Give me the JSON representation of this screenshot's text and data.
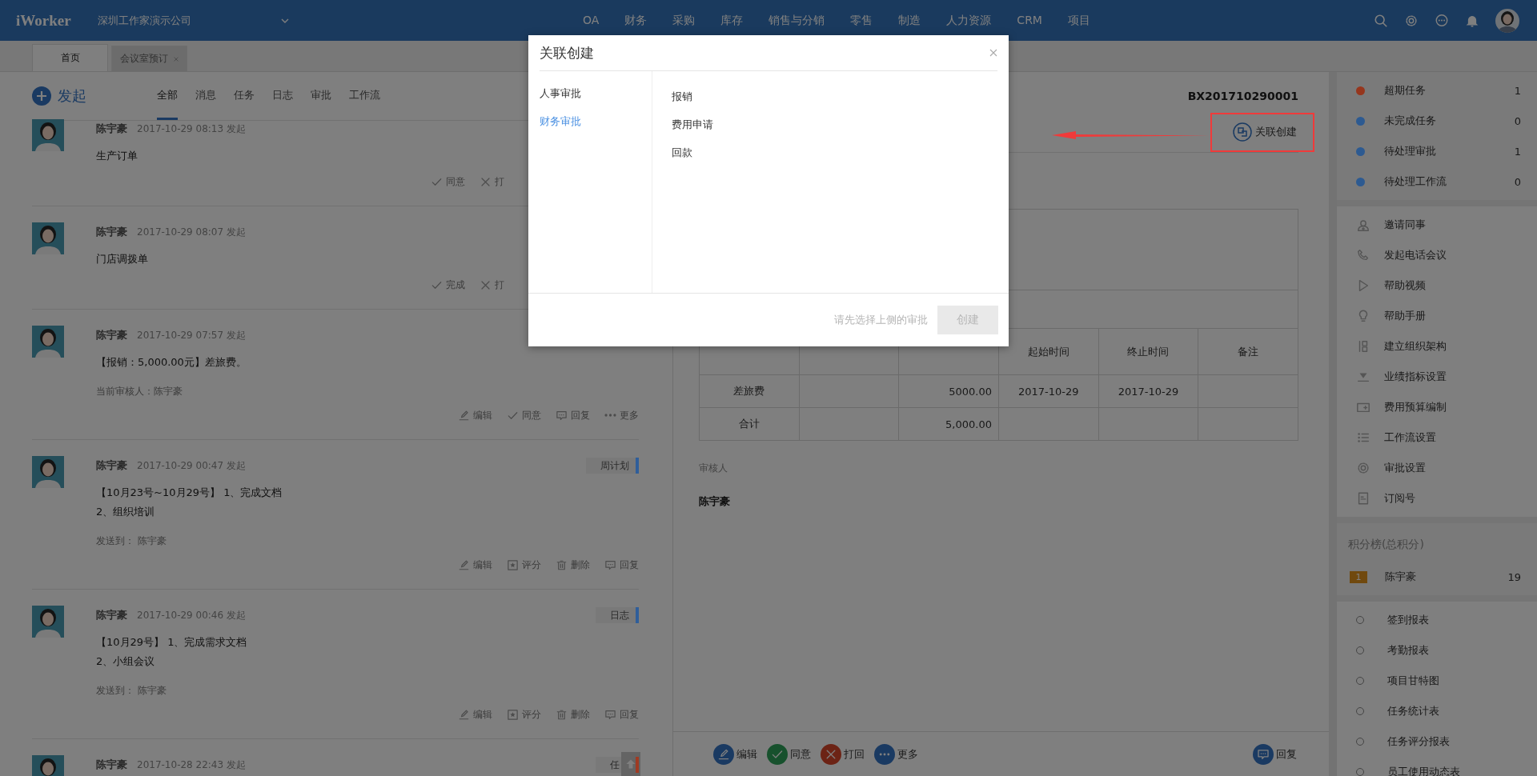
{
  "topbar": {
    "logo": "iWorker",
    "company": "深圳工作家演示公司",
    "nav": [
      "OA",
      "财务",
      "采购",
      "库存",
      "销售与分销",
      "零售",
      "制造",
      "人力资源",
      "CRM",
      "项目"
    ]
  },
  "page_tabs": [
    {
      "label": "首页",
      "selected": true,
      "closable": false
    },
    {
      "label": "会议室预订",
      "selected": false,
      "closable": true
    }
  ],
  "feed": {
    "new_button": "发起",
    "filters": [
      {
        "label": "全部",
        "selected": true
      },
      {
        "label": "消息",
        "selected": false
      },
      {
        "label": "任务",
        "selected": false
      },
      {
        "label": "日志",
        "selected": false
      },
      {
        "label": "审批",
        "selected": false
      },
      {
        "label": "工作流",
        "selected": false
      }
    ],
    "items": [
      {
        "name": "陈宇豪",
        "time": "2017-10-29 08:13 发起",
        "body": [
          "生产订单"
        ],
        "actions": [
          {
            "kind": "agree",
            "label": "同意"
          },
          {
            "kind": "reject",
            "label": "打"
          }
        ]
      },
      {
        "name": "陈宇豪",
        "time": "2017-10-29 08:07 发起",
        "body": [
          "门店调拨单"
        ],
        "actions": [
          {
            "kind": "complete",
            "label": "完成"
          },
          {
            "kind": "reject",
            "label": "打"
          }
        ]
      },
      {
        "name": "陈宇豪",
        "time": "2017-10-29 07:57 发起",
        "body": [
          "【报销：5,000.00元】差旅费。"
        ],
        "meta": "当前审核人：陈宇豪",
        "actions": [
          {
            "kind": "edit",
            "label": "编辑"
          },
          {
            "kind": "agree",
            "label": "同意"
          },
          {
            "kind": "reply",
            "label": "回复"
          },
          {
            "kind": "more",
            "label": "更多"
          }
        ]
      },
      {
        "name": "陈宇豪",
        "time": "2017-10-29 00:47 发起",
        "tag": {
          "label": "周计划",
          "color": "#2f5e9a"
        },
        "body": [
          "【10月23号~10月29号】 1、完成文档",
          "2、组织培训"
        ],
        "meta": "发送到： 陈宇豪",
        "actions": [
          {
            "kind": "edit",
            "label": "编辑"
          },
          {
            "kind": "rate",
            "label": "评分"
          },
          {
            "kind": "delete",
            "label": "删除"
          },
          {
            "kind": "reply",
            "label": "回复"
          }
        ]
      },
      {
        "name": "陈宇豪",
        "time": "2017-10-29 00:46 发起",
        "tag": {
          "label": "日志",
          "color": "#2f5e9a"
        },
        "body": [
          "【10月29号】 1、完成需求文档",
          "2、小组会议"
        ],
        "meta": "发送到： 陈宇豪",
        "actions": [
          {
            "kind": "edit",
            "label": "编辑"
          },
          {
            "kind": "rate",
            "label": "评分"
          },
          {
            "kind": "delete",
            "label": "删除"
          },
          {
            "kind": "reply",
            "label": "回复"
          }
        ]
      },
      {
        "name": "陈宇豪",
        "time": "2017-10-28 22:43 发起",
        "tag": {
          "label": "任",
          "color": "#a03a22"
        }
      }
    ]
  },
  "detail": {
    "number": "BX201710290001",
    "link_button": "关联创建",
    "table": {
      "header": [
        "起始时间",
        "终止时间",
        "备注"
      ],
      "rows": [
        {
          "item": "差旅费",
          "amount": "5000.00",
          "start": "2017-10-29",
          "end": "2017-10-29"
        },
        {
          "item": "合计",
          "amount": "5,000.00"
        }
      ]
    },
    "reviewer_label": "审核人",
    "reviewer": "陈宇豪",
    "actions": [
      {
        "kind": "edit",
        "label": "编辑"
      },
      {
        "kind": "agree",
        "label": "同意"
      },
      {
        "kind": "reject",
        "label": "打回"
      },
      {
        "kind": "more",
        "label": "更多"
      }
    ],
    "reply": "回复"
  },
  "sidebar": {
    "counters": [
      {
        "label": "超期任务",
        "count": "1",
        "color": "#96361d"
      },
      {
        "label": "未完成任务",
        "count": "0",
        "color": "#2d5a91"
      },
      {
        "label": "待处理审批",
        "count": "1",
        "color": "#2d5a91"
      },
      {
        "label": "待处理工作流",
        "count": "0",
        "color": "#2d5a91"
      }
    ],
    "menu": [
      {
        "kind": "invite",
        "label": "邀请同事"
      },
      {
        "kind": "phone",
        "label": "发起电话会议"
      },
      {
        "kind": "video",
        "label": "帮助视频"
      },
      {
        "kind": "manual",
        "label": "帮助手册"
      },
      {
        "kind": "org",
        "label": "建立组织架构"
      },
      {
        "kind": "kpi",
        "label": "业绩指标设置"
      },
      {
        "kind": "budget",
        "label": "费用预算编制"
      },
      {
        "kind": "workflow",
        "label": "工作流设置"
      },
      {
        "kind": "settings",
        "label": "审批设置"
      },
      {
        "kind": "subscribe",
        "label": "订阅号"
      }
    ],
    "leaderboard": {
      "title": "积分榜(总积分)",
      "entries": [
        {
          "rank": "1",
          "name": "陈宇豪",
          "score": "19"
        }
      ]
    },
    "reports": [
      "签到报表",
      "考勤报表",
      "项目甘特图",
      "任务统计表",
      "任务评分报表",
      "员工使用动态表"
    ]
  },
  "modal": {
    "title": "关联创建",
    "categories": [
      {
        "label": "人事审批",
        "selected": false
      },
      {
        "label": "财务审批",
        "selected": true
      }
    ],
    "types": [
      "报销",
      "费用申请",
      "回款"
    ],
    "hint": "请先选择上侧的审批",
    "create_button": {
      "label": "创建",
      "disabled": true
    }
  }
}
